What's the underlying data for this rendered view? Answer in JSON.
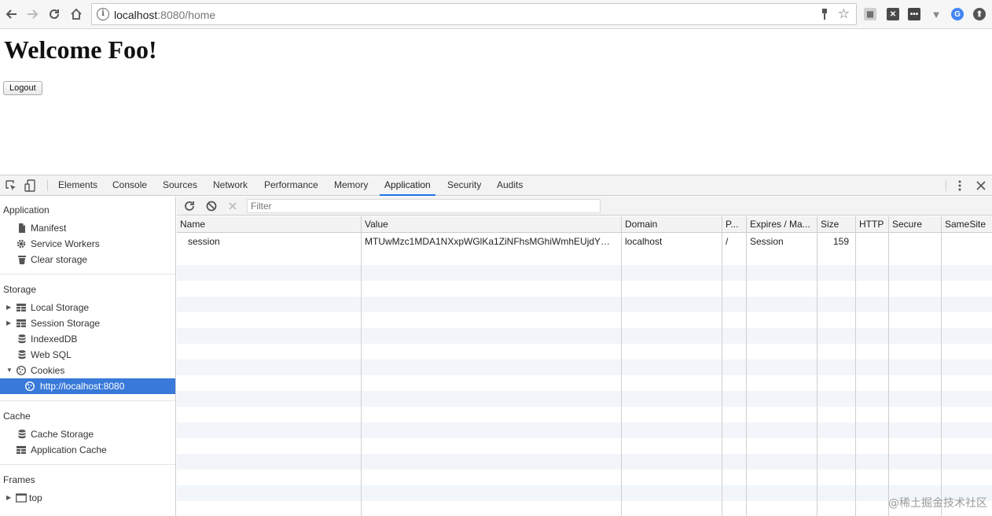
{
  "browser": {
    "url_host": "localhost",
    "url_rest": ":8080/home",
    "back_icon": "arrow-left-icon",
    "forward_icon": "arrow-right-icon",
    "reload_icon": "reload-icon",
    "home_icon": "home-icon"
  },
  "page": {
    "title": "Welcome Foo!",
    "logout_label": "Logout"
  },
  "devtools": {
    "tabs": [
      "Elements",
      "Console",
      "Sources",
      "Network",
      "Performance",
      "Memory",
      "Application",
      "Security",
      "Audits"
    ],
    "active_tab": "Application",
    "sidebar": {
      "application_header": "Application",
      "application_items": [
        "Manifest",
        "Service Workers",
        "Clear storage"
      ],
      "storage_header": "Storage",
      "storage_items": [
        "Local Storage",
        "Session Storage",
        "IndexedDB",
        "Web SQL",
        "Cookies"
      ],
      "cookie_origin": "http://localhost:8080",
      "cache_header": "Cache",
      "cache_items": [
        "Cache Storage",
        "Application Cache"
      ],
      "frames_header": "Frames",
      "frames_items": [
        "top"
      ]
    },
    "filter_placeholder": "Filter",
    "columns": [
      "Name",
      "Value",
      "Domain",
      "P...",
      "Expires / Ma...",
      "Size",
      "HTTP",
      "Secure",
      "SameSite"
    ],
    "rows": [
      {
        "name": "session",
        "value": "MTUwMzc1MDA1NXxpWGlKa1ZiNFhsMGhiWmhEUjdY…",
        "domain": "localhost",
        "path": "/",
        "expires": "Session",
        "size": "159",
        "http": "",
        "secure": "",
        "samesite": ""
      }
    ]
  },
  "watermark": "@稀土掘金技术社区"
}
